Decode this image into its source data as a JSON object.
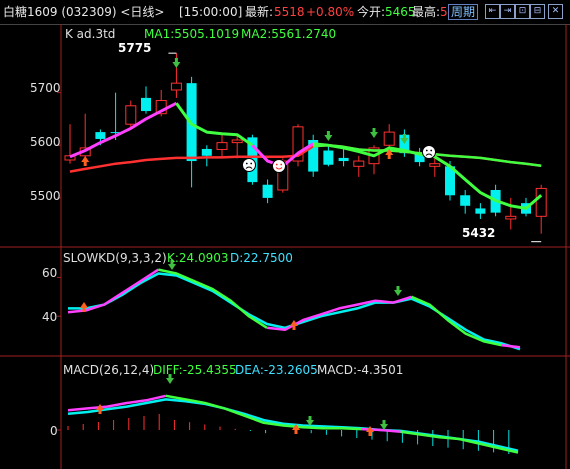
{
  "header": {
    "title": "白糖1609 (032309) <日线>",
    "time": "[15:00:00]",
    "latest_label": "最新:",
    "latest_value": "5518",
    "change": "+0.80%",
    "open_label": "今开:",
    "open_value": "5465",
    "high_label": "最高:",
    "high_value": "5",
    "period_button": "周期",
    "window_buttons": [
      "⇤",
      "⇥",
      "⊡",
      "⊟",
      "✕"
    ]
  },
  "main_panel": {
    "label_k": "K  ad.3td",
    "ma1": "MA1:5505.1019",
    "ma2": "MA2:5561.2740",
    "high_marker": "5775",
    "low_marker": "5432",
    "y_ticks": [
      "5700",
      "5600",
      "5500"
    ]
  },
  "kd_panel": {
    "label": "SLOWKD(9,3,3,2)",
    "k": "K:24.0903",
    "d": "D:22.7500",
    "y_ticks": [
      "60",
      "40"
    ]
  },
  "macd_panel": {
    "label": "MACD(26,12,4)",
    "diff": "DIFF:-25.4355",
    "dea": "DEA:-23.2605",
    "macd": "MACD:-4.3501",
    "y_ticks": [
      "0"
    ]
  },
  "chart_data": [
    {
      "type": "candlestick",
      "title": "K ad.3td",
      "ylim": [
        5420,
        5800
      ],
      "y_ticks": [
        5500,
        5600,
        5700
      ],
      "candles": [
        {
          "o": 5572,
          "h": 5640,
          "l": 5565,
          "c": 5580,
          "color": "red"
        },
        {
          "o": 5580,
          "h": 5660,
          "l": 5570,
          "c": 5595,
          "color": "red"
        },
        {
          "o": 5612,
          "h": 5630,
          "l": 5600,
          "c": 5625,
          "color": "cyan"
        },
        {
          "o": 5625,
          "h": 5700,
          "l": 5610,
          "c": 5625,
          "color": "cyan"
        },
        {
          "o": 5640,
          "h": 5685,
          "l": 5630,
          "c": 5675,
          "color": "red"
        },
        {
          "o": 5690,
          "h": 5712,
          "l": 5660,
          "c": 5665,
          "color": "cyan"
        },
        {
          "o": 5660,
          "h": 5705,
          "l": 5655,
          "c": 5685,
          "color": "red"
        },
        {
          "o": 5705,
          "h": 5775,
          "l": 5690,
          "c": 5718,
          "color": "red"
        },
        {
          "o": 5718,
          "h": 5730,
          "l": 5520,
          "c": 5570,
          "color": "cyan"
        },
        {
          "o": 5580,
          "h": 5600,
          "l": 5560,
          "c": 5593,
          "color": "cyan"
        },
        {
          "o": 5592,
          "h": 5620,
          "l": 5575,
          "c": 5605,
          "color": "red"
        },
        {
          "o": 5605,
          "h": 5620,
          "l": 5575,
          "c": 5610,
          "color": "red"
        },
        {
          "o": 5615,
          "h": 5620,
          "l": 5525,
          "c": 5530,
          "color": "cyan"
        },
        {
          "o": 5525,
          "h": 5535,
          "l": 5490,
          "c": 5500,
          "color": "cyan"
        },
        {
          "o": 5515,
          "h": 5575,
          "l": 5510,
          "c": 5570,
          "color": "red"
        },
        {
          "o": 5570,
          "h": 5640,
          "l": 5560,
          "c": 5635,
          "color": "red"
        },
        {
          "o": 5610,
          "h": 5620,
          "l": 5540,
          "c": 5550,
          "color": "cyan"
        },
        {
          "o": 5590,
          "h": 5600,
          "l": 5560,
          "c": 5563,
          "color": "cyan"
        },
        {
          "o": 5576,
          "h": 5595,
          "l": 5560,
          "c": 5570,
          "color": "cyan"
        },
        {
          "o": 5560,
          "h": 5580,
          "l": 5540,
          "c": 5570,
          "color": "red"
        },
        {
          "o": 5565,
          "h": 5600,
          "l": 5545,
          "c": 5595,
          "color": "red"
        },
        {
          "o": 5600,
          "h": 5640,
          "l": 5590,
          "c": 5625,
          "color": "red"
        },
        {
          "o": 5620,
          "h": 5630,
          "l": 5578,
          "c": 5585,
          "color": "cyan"
        },
        {
          "o": 5585,
          "h": 5595,
          "l": 5560,
          "c": 5568,
          "color": "cyan"
        },
        {
          "o": 5565,
          "h": 5575,
          "l": 5540,
          "c": 5560,
          "color": "red"
        },
        {
          "o": 5560,
          "h": 5570,
          "l": 5495,
          "c": 5505,
          "color": "cyan"
        },
        {
          "o": 5505,
          "h": 5515,
          "l": 5470,
          "c": 5485,
          "color": "cyan"
        },
        {
          "o": 5480,
          "h": 5490,
          "l": 5460,
          "c": 5470,
          "color": "cyan"
        },
        {
          "o": 5515,
          "h": 5525,
          "l": 5465,
          "c": 5472,
          "color": "cyan"
        },
        {
          "o": 5465,
          "h": 5500,
          "l": 5440,
          "c": 5460,
          "color": "red"
        },
        {
          "o": 5490,
          "h": 5500,
          "l": 5465,
          "c": 5470,
          "color": "cyan"
        },
        {
          "o": 5465,
          "h": 5525,
          "l": 5432,
          "c": 5518,
          "color": "red"
        }
      ],
      "ma1": [
        5578,
        5590,
        5605,
        5618,
        5632,
        5650,
        5665,
        5680,
        5640,
        5625,
        5622,
        5620,
        5600,
        5570,
        5560,
        5585,
        5603,
        5600,
        5595,
        5588,
        5580,
        5595,
        5590,
        5583,
        5578,
        5560,
        5535,
        5510,
        5495,
        5485,
        5480,
        5505
      ],
      "ma2": [
        5550,
        5555,
        5560,
        5565,
        5568,
        5572,
        5574,
        5576,
        5576,
        5577,
        5577,
        5578,
        5578,
        5578,
        5578,
        5580,
        5598,
        5600,
        5597,
        5592,
        5590,
        5590,
        5588,
        5585,
        5583,
        5580,
        5578,
        5576,
        5572,
        5568,
        5565,
        5561
      ],
      "high_marker": 5775,
      "low_marker": 5432
    },
    {
      "type": "line",
      "title": "SLOWKD(9,3,3,2)",
      "ylim": [
        20,
        70
      ],
      "y_ticks": [
        40,
        60
      ],
      "series": [
        {
          "name": "K",
          "values": [
            42,
            43,
            46,
            52,
            58,
            64,
            62,
            58,
            54,
            48,
            40,
            34,
            33,
            38,
            41,
            44,
            46,
            48,
            47,
            50,
            46,
            38,
            31,
            27,
            25,
            24
          ]
        },
        {
          "name": "D",
          "values": [
            44,
            44,
            46,
            51,
            57,
            62,
            61,
            57,
            53,
            47,
            41,
            36,
            34,
            37,
            40,
            42,
            44,
            47,
            47,
            49,
            45,
            39,
            33,
            28,
            26,
            23
          ]
        }
      ]
    },
    {
      "type": "line",
      "title": "MACD(26,12,4)",
      "y_ticks": [
        0
      ],
      "series": [
        {
          "name": "DIFF",
          "values": [
            22,
            24,
            26,
            30,
            33,
            38,
            34,
            30,
            24,
            16,
            8,
            5,
            3,
            2,
            2,
            1,
            0,
            -2,
            -5,
            -8,
            -10,
            -15,
            -20,
            -25
          ]
        },
        {
          "name": "DEA",
          "values": [
            18,
            20,
            23,
            26,
            30,
            34,
            32,
            29,
            24,
            18,
            11,
            7,
            5,
            4,
            3,
            2,
            0,
            -1,
            -4,
            -7,
            -10,
            -13,
            -18,
            -23
          ]
        }
      ]
    }
  ]
}
